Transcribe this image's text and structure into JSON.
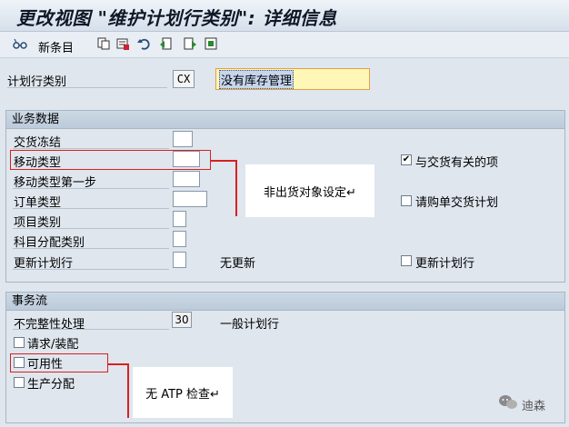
{
  "title": "更改视图 \"维护计划行类别\": 详细信息",
  "toolbar": {
    "new_entries_label": "新条目"
  },
  "header": {
    "category_label": "计划行类别",
    "category_code": "CX",
    "category_desc": "没有库存管理"
  },
  "business": {
    "title": "业务数据",
    "delivery_block_label": "交货冻结",
    "movement_type_label": "移动类型",
    "movement_type_step1_label": "移动类型第一步",
    "order_type_label": "订单类型",
    "item_category_label": "项目类别",
    "acct_assign_label": "科目分配类别",
    "update_sched_label": "更新计划行",
    "no_update_text": "无更新",
    "delivery_relevant_label": "与交货有关的项",
    "purch_req_label": "请购单交货计划",
    "update_sched_cb_label": "更新计划行",
    "delivery_relevant_checked": true
  },
  "transaction": {
    "title": "事务流",
    "incomplete_label": "不完整性处理",
    "incomplete_value": "30",
    "incomplete_text": "一般计划行",
    "req_assembly_label": "请求/装配",
    "availability_label": "可用性",
    "prod_alloc_label": "生产分配"
  },
  "annotations": {
    "note1": "非出货对象设定↵",
    "note2": "无 ATP 检查↵"
  },
  "watermark": "迪森",
  "colors": {
    "annotation_red": "#d92020",
    "input_highlight": "#fff7b5"
  }
}
